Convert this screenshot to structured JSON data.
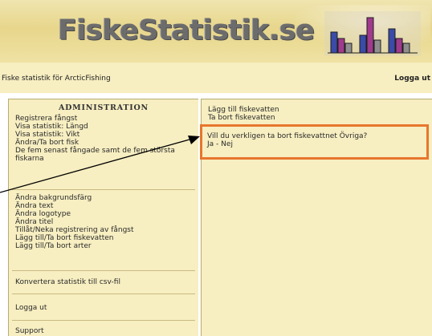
{
  "header": {
    "logo_text": "FiskeStatistik.se",
    "tagline": "Fiske statistik för ArcticFishing",
    "logout": "Logga ut"
  },
  "colors": {
    "banner": "#e7d68b",
    "panel": "#f7eec1",
    "highlight_box": "#e8762d",
    "bar_blue": "#3b4ba8",
    "bar_magenta": "#a03a8c",
    "bar_gray": "#8f8f8f"
  },
  "sidebar": {
    "heading": "ADMINISTRATION",
    "groups": [
      {
        "items": [
          "Registrera fångst",
          "Visa statistik: Längd",
          "Visa statistik: Vikt",
          "Ändra/Ta bort fisk",
          "De fem senast fångade samt de fem största fiskarna"
        ]
      },
      {
        "items": [
          "Ändra bakgrundsfärg",
          "Ändra text",
          "Ändra logotype",
          "Ändra titel",
          "Tillåt/Neka registrering av fångst",
          "Lägg till/Ta bort fiskevatten",
          "Lägg till/Ta bort arter"
        ]
      },
      {
        "items": [
          "Konvertera statistik till csv-fil"
        ]
      },
      {
        "items": [
          "Logga ut"
        ]
      },
      {
        "items": [
          "Support"
        ]
      }
    ]
  },
  "content": {
    "links": [
      "Lägg till fiskevatten",
      "Ta bort fiskevatten"
    ],
    "confirm": {
      "question": "Vill du verkligen ta bort fiskevattnet Övriga?",
      "yes": "Ja",
      "separator": "-",
      "no": "Nej"
    }
  }
}
